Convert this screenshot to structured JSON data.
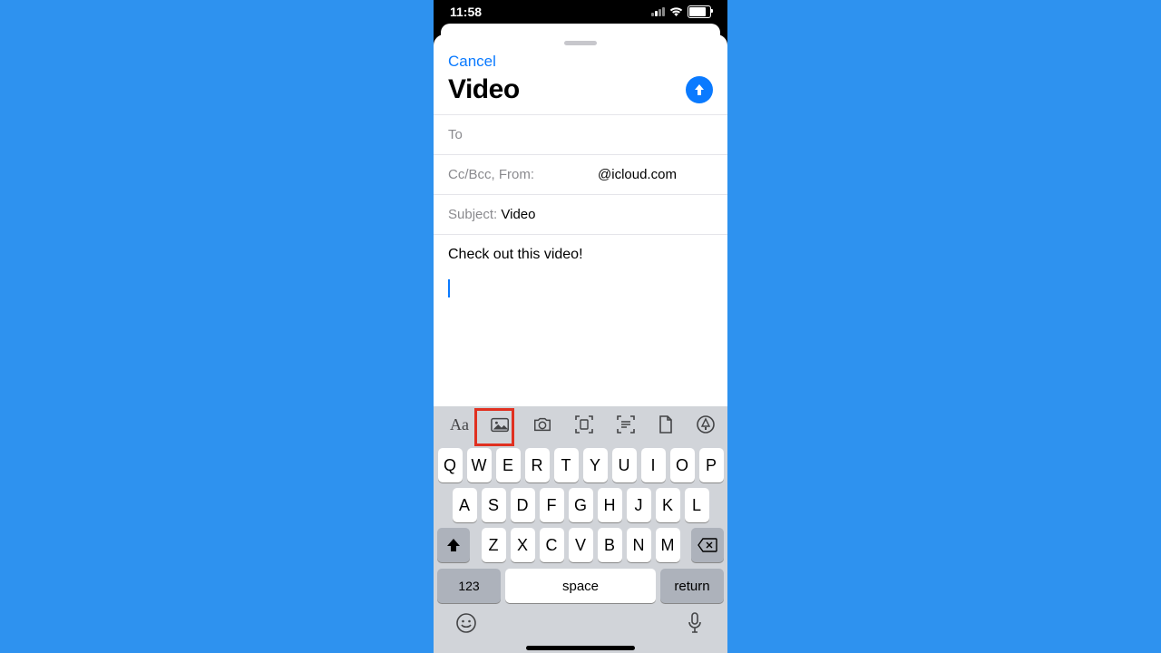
{
  "status": {
    "time": "11:58"
  },
  "compose": {
    "cancel": "Cancel",
    "title": "Video",
    "to_label": "To",
    "ccbcc_label": "Cc/Bcc, From:",
    "from_value": "@icloud.com",
    "subject_label": "Subject:",
    "subject_value": "Video",
    "body_text": "Check out this video!"
  },
  "keyboard": {
    "row1": [
      "Q",
      "W",
      "E",
      "R",
      "T",
      "Y",
      "U",
      "I",
      "O",
      "P"
    ],
    "row2": [
      "A",
      "S",
      "D",
      "F",
      "G",
      "H",
      "J",
      "K",
      "L"
    ],
    "row3": [
      "Z",
      "X",
      "C",
      "V",
      "B",
      "N",
      "M"
    ],
    "num": "123",
    "space": "space",
    "return": "return"
  },
  "toolbar": {
    "items": [
      "text-format",
      "photo-library",
      "camera",
      "scan-document",
      "scan-text",
      "attach-file",
      "markup"
    ]
  },
  "highlight": "photo-library"
}
